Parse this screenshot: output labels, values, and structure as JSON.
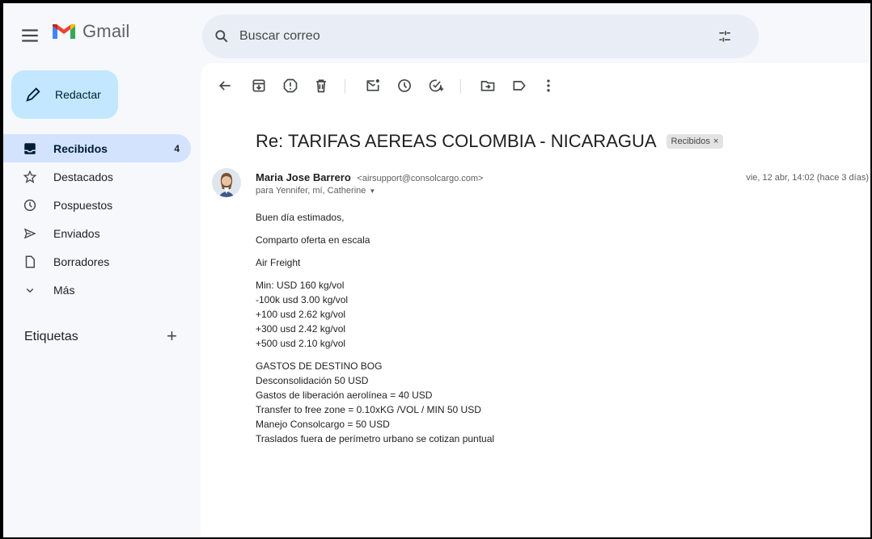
{
  "app": {
    "name": "Gmail"
  },
  "search": {
    "placeholder": "Buscar correo"
  },
  "sidebar": {
    "compose_label": "Redactar",
    "items": [
      {
        "label": "Recibidos",
        "count": "4",
        "icon": "inbox-icon"
      },
      {
        "label": "Destacados",
        "icon": "star-icon"
      },
      {
        "label": "Pospuestos",
        "icon": "clock-icon"
      },
      {
        "label": "Enviados",
        "icon": "send-icon"
      },
      {
        "label": "Borradores",
        "icon": "draft-icon"
      },
      {
        "label": "Más",
        "icon": "chevron-down-icon"
      }
    ],
    "labels_heading": "Etiquetas",
    "labels_add": "+"
  },
  "toolbar": {
    "icons": [
      "back-arrow-icon",
      "archive-icon",
      "report-spam-icon",
      "delete-icon",
      "mark-unread-icon",
      "snooze-icon",
      "add-task-icon",
      "move-to-icon",
      "label-icon",
      "more-vert-icon"
    ]
  },
  "email": {
    "subject": "Re: TARIFAS AEREAS COLOMBIA - NICARAGUA",
    "label_chip": "Recibidos",
    "label_chip_close": "×",
    "sender_name": "Maria Jose Barrero",
    "sender_email": "<airsupport@consolcargo.com>",
    "recipients": "para Yennifer, mí, Catherine",
    "date": "vie, 12 abr, 14:02 (hace 3 días)",
    "body": {
      "greeting": "Buen día estimados,",
      "intro": "Comparto oferta en escala",
      "freight_title": "Air Freight",
      "rates": [
        "Min: USD 160 kg/vol",
        "-100k usd 3.00 kg/vol",
        "+100 usd 2.62 kg/vol",
        "+300 usd 2.42 kg/vol",
        "+500 usd 2.10 kg/vol"
      ],
      "dest_title": "GASTOS DE DESTINO BOG",
      "dest_items": [
        "Desconsolidación 50 USD",
        "Gastos de liberación aerolínea = 40 USD",
        "Transfer to free zone =  0.10xKG /VOL / MIN 50 USD",
        "Manejo Consolcargo = 50 USD",
        "Traslados fuera de perímetro urbano se cotizan puntual"
      ]
    }
  },
  "colors": {
    "accent": "#c2e7ff",
    "active_nav": "#d3e3fd",
    "background": "#f6f8fc",
    "search_bg": "#e9eef6"
  }
}
